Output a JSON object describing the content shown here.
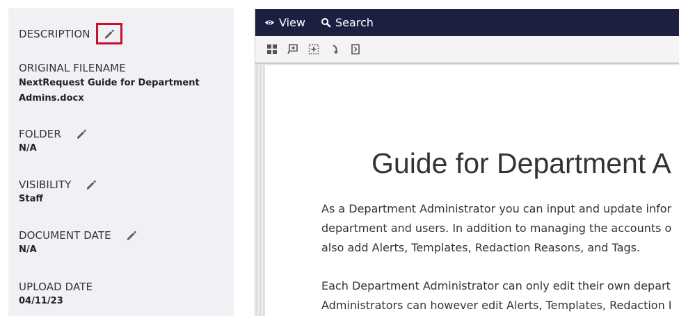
{
  "metadata": {
    "description_label": "DESCRIPTION",
    "original_filename_label": "ORIGINAL FILENAME",
    "original_filename_line1": "NextRequest Guide for Department",
    "original_filename_line2": "Admins.docx",
    "folder_label": "FOLDER",
    "folder_value": "N/A",
    "visibility_label": "VISIBILITY",
    "visibility_value": "Staff",
    "document_date_label": "DOCUMENT DATE",
    "document_date_value": "N/A",
    "upload_date_label": "UPLOAD DATE",
    "upload_date_value": "04/11/23"
  },
  "viewer": {
    "view_label": "View",
    "search_label": "Search",
    "toolbar_icons": [
      "thumbnails-icon",
      "zoom-comment-icon",
      "fit-selection-icon",
      "rotate-icon",
      "page-icon"
    ]
  },
  "document": {
    "title": "Guide for Department A",
    "para1_line1": "As a Department Administrator you can input and update infor",
    "para1_line2": "department and users. In addition to managing the accounts o",
    "para1_line3": "also add Alerts, Templates, Redaction Reasons, and Tags.",
    "para2_line1": "Each Department Administrator can only edit their own depart",
    "para2_line2": "Administrators can however edit Alerts, Templates, Redaction I"
  },
  "colors": {
    "highlight": "#c8102e",
    "topbar": "#1c1f3f",
    "panel": "#f1f1f5"
  }
}
